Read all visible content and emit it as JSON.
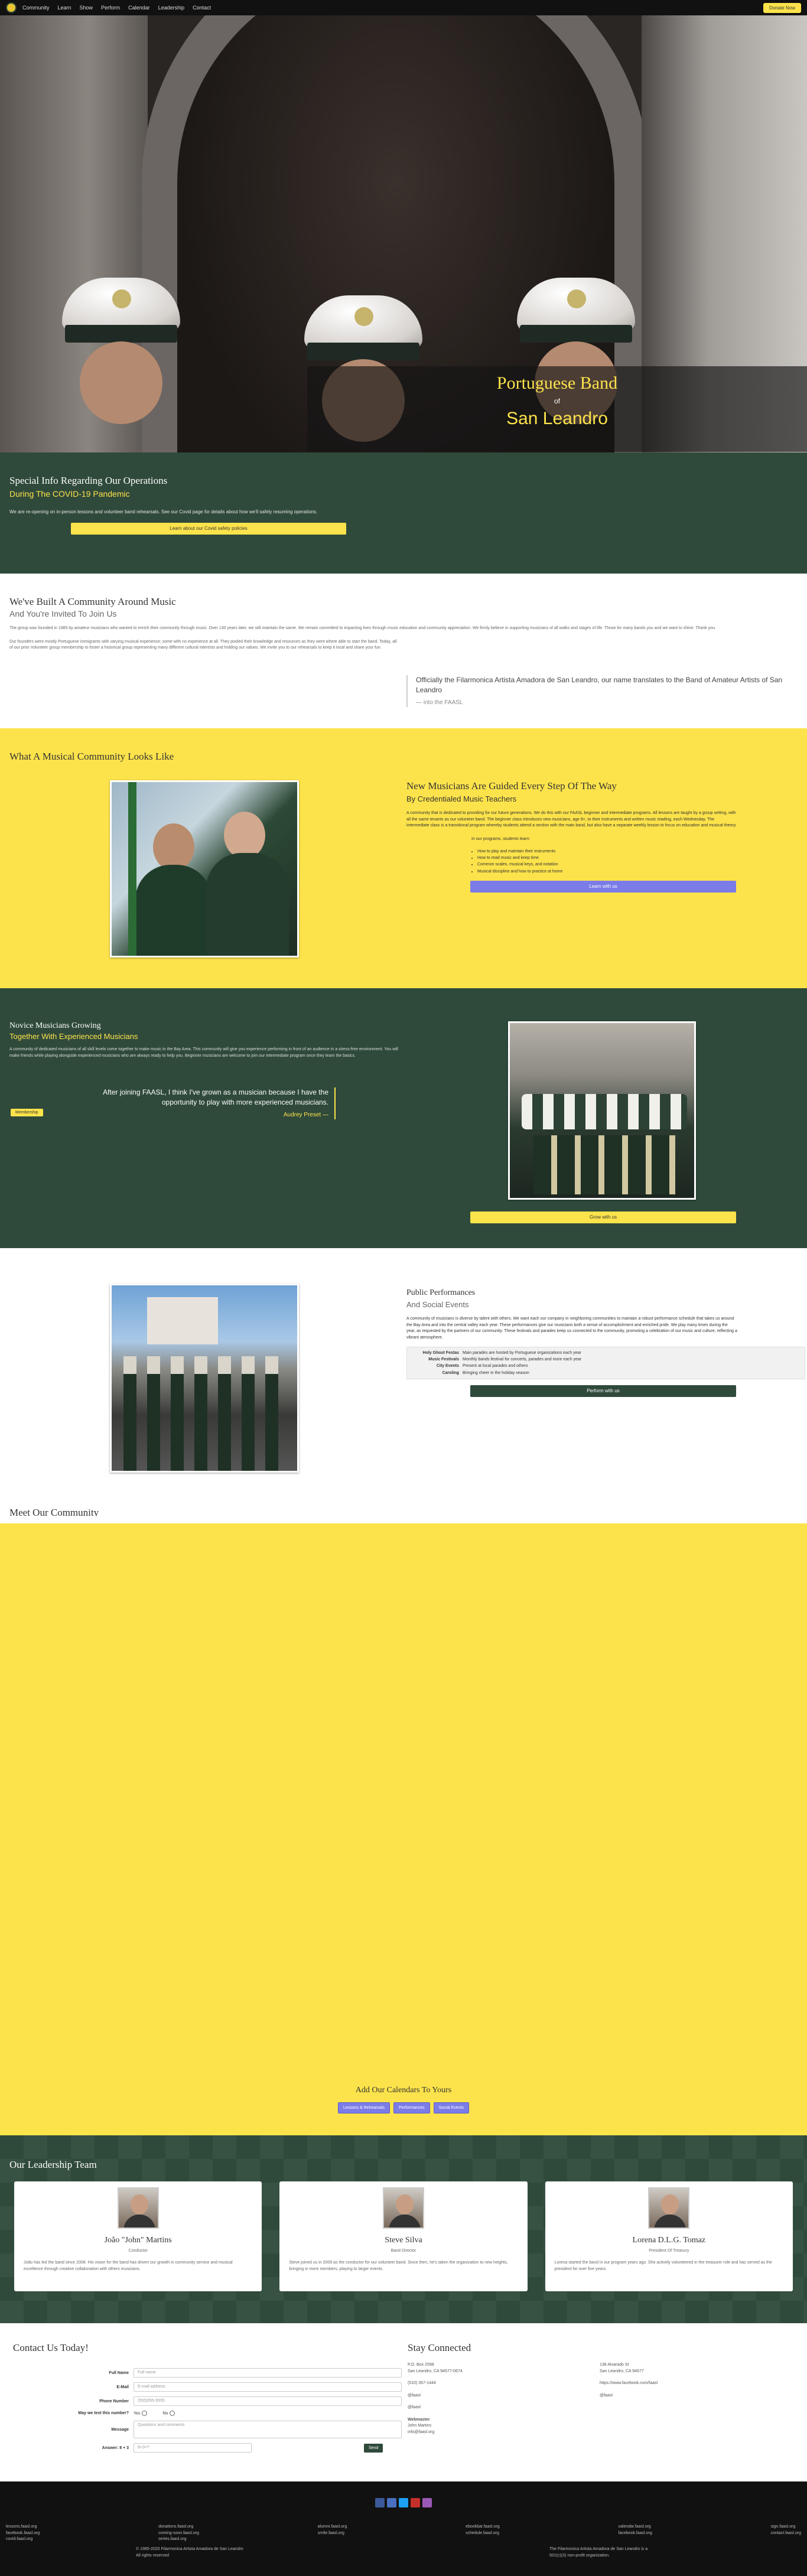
{
  "nav": {
    "links": [
      "Community",
      "Learn",
      "Show",
      "Perform",
      "Calendar",
      "Leadership",
      "Contact"
    ],
    "donate": "Donate Now"
  },
  "hero": {
    "title": "Portuguese Band",
    "of": "of",
    "city": "San Leandro"
  },
  "covid": {
    "title": "Special Info Regarding Our Operations",
    "subtitle": "During The COVID-19 Pandemic",
    "text": "We are re-opening on in-person lessons and volunteer band rehearsals. See our Covid page for details about how we'll safely resuming operations.",
    "button": "Learn about our Covid safety policies"
  },
  "community": {
    "title": "We've Built A Community Around Music",
    "subtitle": "And You're Invited To Join Us",
    "p1": "The group was founded in 1985 by amateur musicians who wanted to enrich their community through music. Over 130 years later, we still maintain the same. We remain committed to impacting lives through music education and community appreciation. We firmly believe in supporting musicians of all walks and stages of life. Those for many bands you and we want to shine. Thank you.",
    "p2": "Our founders were mostly Portuguese immigrants with varying musical experience; some with no experience at all. They pooled their knowledge and resources as they went where able to start the band. Today, all of our prior Volunteer group membership to foster a historical group representing many different cultural interests and holding our values. We invite you to our rehearsals to keep it local and share your fun.",
    "quote": "Officially the Filarmonica Artista Amadora de San Leandro, our name translates to the Band of Amateur Artists of San Leandro",
    "quote_src": "— into the FAASL"
  },
  "musical": {
    "section_title": "What A Musical Community Looks Like",
    "title": "New Musicians Are Guided Every Step Of The Way",
    "subtitle": "By Credentialed Music Teachers",
    "text": "A community that is dedicated to providing for our future generations. We do this with our FAASL beginner and intermediate programs. All lessons are taught by a group setting, with all the same tenants as our volunteer band. The beginner class introduces new musicians, age 8+, to their instruments and written music reading, each Wednesday. The intermediate class is a transitional program whereby students attend a section with the main band, but also have a separate weekly lesson to focus on education and musical theory.",
    "list_intro": "In our programs, students learn:",
    "list": [
      "How to play and maintain their instruments",
      "How to read music and keep time",
      "Common scales, musical keys, and notation",
      "Musical discipline and how to practice at home"
    ],
    "button": "Learn with us"
  },
  "novice": {
    "title": "Novice Musicians Growing",
    "subtitle": "Together With Experienced Musicians",
    "text": "A community of dedicated musicians of all skill levels come together to make music in the Bay Area. This community will give you experience performing in front of an audience in a stress-free environment. You will make friends while playing alongside experienced musicians who are always ready to help you. Beginner musicians are welcome to join our intermediate program once they learn the basics.",
    "quote": "After joining FAASL, I think I've grown as a musician because I have the opportunity to play with more experienced musicians.",
    "quote_src": "Audrey Preset —",
    "member_button": "Membership",
    "button": "Grow with us"
  },
  "public": {
    "title": "Public Performances",
    "subtitle": "And Social Events",
    "text": "A community of musicians is diverse by talent with others. We want each our company in neighboring communities to maintain a robust performance schedule that takes us around the Bay Area and into the central valley each year. These performances give our musicians both a sense of accomplishment and enriched pride. We play many times during the year, as requested by the partners of our community. These festivals and parades keep us connected to the community, promoting a celebration of our music and culture, reflecting a vibrant atmosphere.",
    "rows": [
      {
        "k": "Holy Ghost Festas",
        "v": "Main parades are hosted by Portuguese organizations each year"
      },
      {
        "k": "Music Festivals",
        "v": "Monthly bands festival for concerts, parades and more each year"
      },
      {
        "k": "City Events",
        "v": "Present at local parades and others"
      },
      {
        "k": "Caroling",
        "v": "Bringing cheer in the holiday season"
      }
    ],
    "button": "Perform with us"
  },
  "meet": {
    "title": "Meet Our Community",
    "calendars_title": "Add Our Calendars To Yours",
    "calendars": [
      "Lessons & Rehearsals",
      "Performances",
      "Social Events"
    ]
  },
  "leadership": {
    "title": "Our Leadership Team",
    "members": [
      {
        "name": "João \"John\" Martins",
        "role": "Conductor",
        "bio": "João has led the band since 2008. His vision for the band has driven our growth in community service and musical excellence through creative collaboration with others musicians."
      },
      {
        "name": "Steve Silva",
        "role": "Band Director",
        "bio": "Steve joined us in 2009 as the conductor for our volunteer band. Since then, he's taken the organization to new heights, bringing in more members, playing to larger events."
      },
      {
        "name": "Lorena D.L.G. Tomaz",
        "role": "President Of Treasury",
        "bio": "Lorena started the band in our program years ago. She actively volunteered in the treasurer role and has served as the president for over five years."
      }
    ]
  },
  "contact": {
    "title": "Contact Us Today!",
    "fields": [
      {
        "label": "Full Name",
        "placeholder": "Full name"
      },
      {
        "label": "E-Mail",
        "placeholder": "E-mail address"
      },
      {
        "label": "Phone Number",
        "placeholder": "(555)555-5555"
      }
    ],
    "radio_label": "May we text this number?",
    "radio_yes": "Yes",
    "radio_no": "No",
    "message_label": "Message",
    "message_placeholder": "Questions and comments",
    "captcha_label": "Answer: 8 + 3",
    "captcha_placeholder": "8+3=?",
    "send": "Send"
  },
  "stay": {
    "title": "Stay Connected",
    "col1": [
      "P.O. Box 2598",
      "San Leandro, CA 94577-0674",
      "(510) 357-1444",
      "",
      "@faasl",
      "",
      "@faasl",
      "",
      "Webmaster",
      "John Martins",
      "info@faasl.org"
    ],
    "col2": [
      "138 Alvarado St",
      "San Leandro, CA 94577",
      "",
      "https://www.facebook.com/faasl",
      "",
      "@faasl"
    ]
  },
  "footer": {
    "social_colors": [
      "#3b5998",
      "#4a6fc0",
      "#1da1f2",
      "#c4302b",
      "#9b59b6"
    ],
    "link_cols": [
      [
        "lessons.faasl.org",
        "facebook.faasl.org",
        "covid.faasl.org"
      ],
      [
        "donations.faasl.org",
        "coming-soon.faasl.org",
        "series.faasl.org"
      ],
      [
        "alumni.faasl.org",
        "smile.faasl.org"
      ],
      [
        "ebookbar.faasl.org",
        "schedule.faasl.org"
      ],
      [
        "calendar.faasl.org",
        "facebook.faasl.org"
      ],
      [
        "sign.faasl.org",
        "contact.faasl.org"
      ]
    ],
    "copyright": "© 1985-2020 Filarmonica Artista Amadora de San Leandro",
    "rights": "All rights reserved",
    "nonprofit": "The Filarmonica Artista Amadora de San Leandro is a",
    "nonprofit2": "501(c)(3) non-profit organization."
  }
}
